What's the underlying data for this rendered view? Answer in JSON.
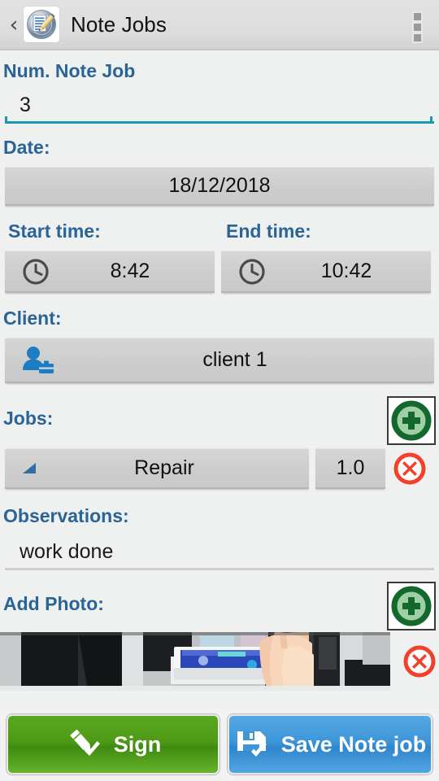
{
  "header": {
    "back_icon": "back-chevron-icon",
    "app_icon": "notepad-pencil-icon",
    "title": "Note Jobs",
    "overflow_icon": "overflow-menu-icon"
  },
  "form": {
    "num_note_job": {
      "label": "Num. Note Job",
      "value": "3",
      "placeholder": ""
    },
    "date": {
      "label": "Date:",
      "value": "18/12/2018"
    },
    "start_time": {
      "label": "Start time:",
      "value": "8:42",
      "icon": "clock-icon"
    },
    "end_time": {
      "label": "End time:",
      "value": "10:42",
      "icon": "clock-icon"
    },
    "client": {
      "label": "Client:",
      "value": "client 1",
      "icon": "client-person-icon"
    },
    "jobs": {
      "label": "Jobs:",
      "add_icon": "add-circle-icon",
      "rows": [
        {
          "name": "Repair",
          "quantity": "1.0",
          "spinner_icon": "spinner-triangle-icon",
          "delete_icon": "delete-circle-icon"
        }
      ]
    },
    "observations": {
      "label": "Observations:",
      "value": "work done",
      "placeholder": ""
    },
    "add_photo": {
      "label": "Add Photo:",
      "add_icon": "add-circle-icon",
      "photos": [
        {
          "alt": "printer ink cartridge being installed by hand",
          "delete_icon": "delete-circle-icon"
        }
      ]
    }
  },
  "actions": {
    "sign": {
      "label": "Sign",
      "icon": "pencil-check-icon"
    },
    "save": {
      "label": "Save Note job",
      "icon": "floppy-check-icon"
    }
  },
  "colors": {
    "label_blue": "#2a6496",
    "focus_teal": "#1d96b2",
    "add_green": "#1b6b30",
    "delete_red": "#f2402b",
    "sign_green": "#4e9a17",
    "save_blue": "#3e96d8",
    "button_gray": "#cdcdcd"
  }
}
